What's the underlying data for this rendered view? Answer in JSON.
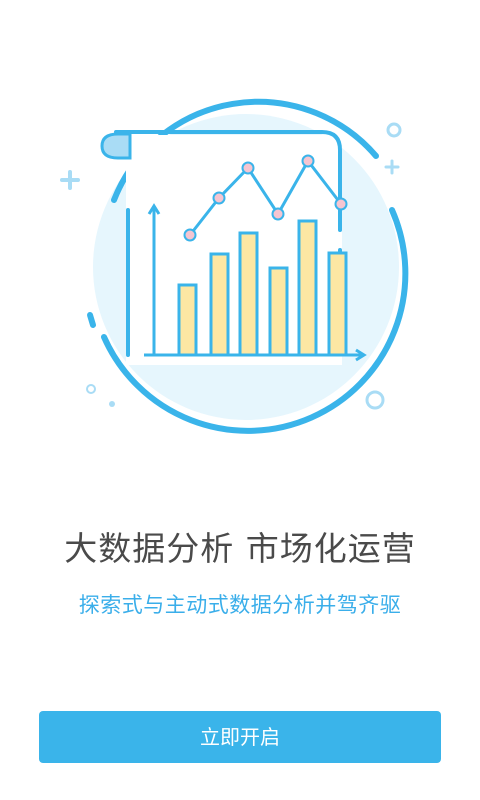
{
  "colors": {
    "accent": "#3ab4ea",
    "headline": "#4a4a4a",
    "circle_fill": "#e6f6fd",
    "bar_fill": "#fde7a3",
    "dot_fill": "#f5c5d1"
  },
  "illustration": {
    "icon": "bar-chart-icon"
  },
  "headline": "大数据分析 市场化运营",
  "subheadline": "探索式与主动式数据分析并驾齐驱",
  "start_button_label": "立即开启"
}
